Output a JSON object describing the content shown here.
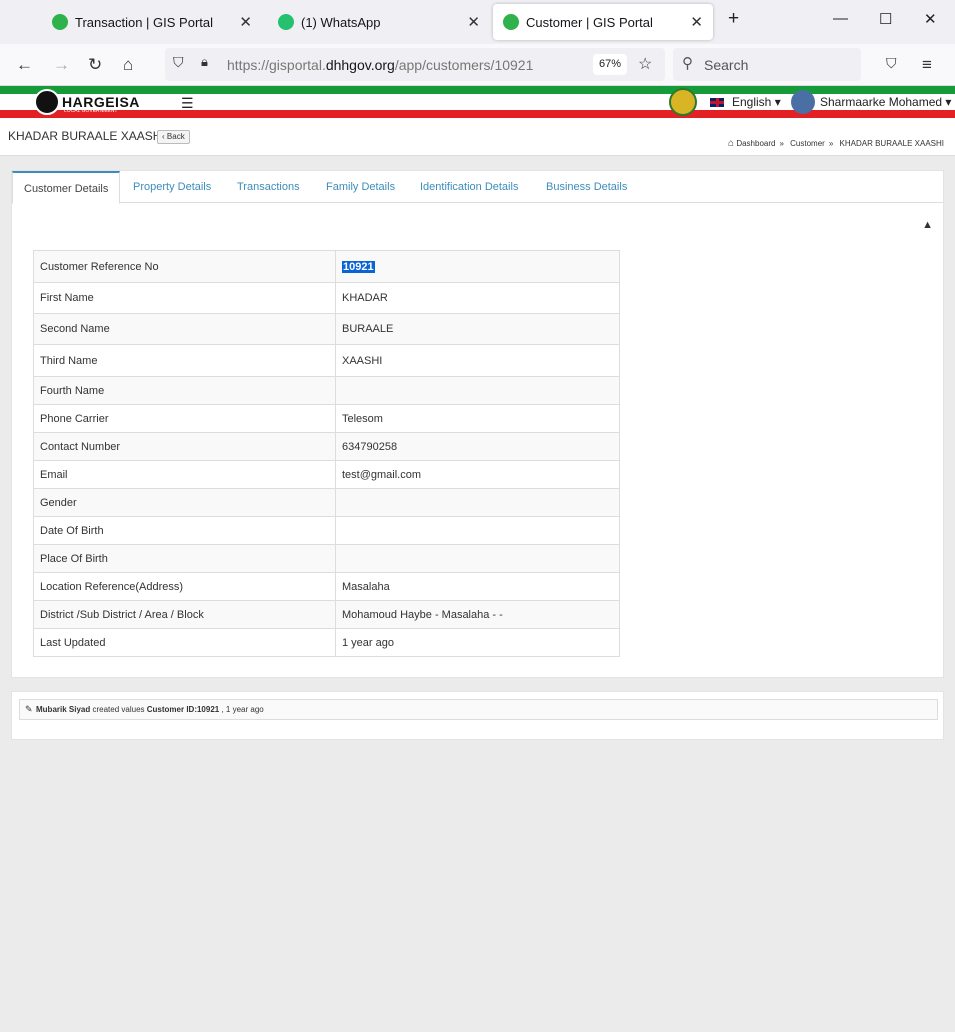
{
  "browser": {
    "tabs": [
      {
        "title": "Transaction | GIS Portal",
        "active": false
      },
      {
        "title": "(1) WhatsApp",
        "active": false
      },
      {
        "title": "Customer | GIS Portal",
        "active": true
      }
    ],
    "url_prefix": "https://gisportal.",
    "url_domain": "dhhgov.org",
    "url_path": "/app/customers/10921",
    "zoom": "67%",
    "search_placeholder": "Search"
  },
  "header": {
    "logo_text": "HARGEISA",
    "logo_sub": "LOCAL GOVERNMENT",
    "language": "English",
    "user_name": "Sharmaarke Mohamed"
  },
  "page": {
    "title": "KHADAR BURAALE XAASHI",
    "back_label": "Back",
    "breadcrumb": [
      "Dashboard",
      "Customer",
      "KHADAR BURAALE XAASHI"
    ]
  },
  "tabs": [
    "Customer Details",
    "Property Details",
    "Transactions",
    "Family Details",
    "Identification Details",
    "Business Details"
  ],
  "details": [
    {
      "label": "Customer Reference No",
      "value": "10921"
    },
    {
      "label": "First Name",
      "value": "KHADAR"
    },
    {
      "label": "Second Name",
      "value": "BURAALE"
    },
    {
      "label": "Third Name",
      "value": "XAASHI"
    },
    {
      "label": "Fourth Name",
      "value": ""
    },
    {
      "label": "Phone Carrier",
      "value": "Telesom"
    },
    {
      "label": "Contact Number",
      "value": "634790258"
    },
    {
      "label": "Email",
      "value": "test@gmail.com"
    },
    {
      "label": "Gender",
      "value": ""
    },
    {
      "label": "Date Of Birth",
      "value": ""
    },
    {
      "label": "Place Of Birth",
      "value": ""
    },
    {
      "label": "Location Reference(Address)",
      "value": "Masalaha"
    },
    {
      "label": "District /Sub District / Area / Block",
      "value": "Mohamoud Haybe - Masalaha - -"
    },
    {
      "label": "Last Updated",
      "value": "1 year ago"
    }
  ],
  "log": {
    "user": "Mubarik Siyad",
    "action": "created values",
    "target": "Customer ID:10921",
    "time": ", 1 year ago"
  }
}
